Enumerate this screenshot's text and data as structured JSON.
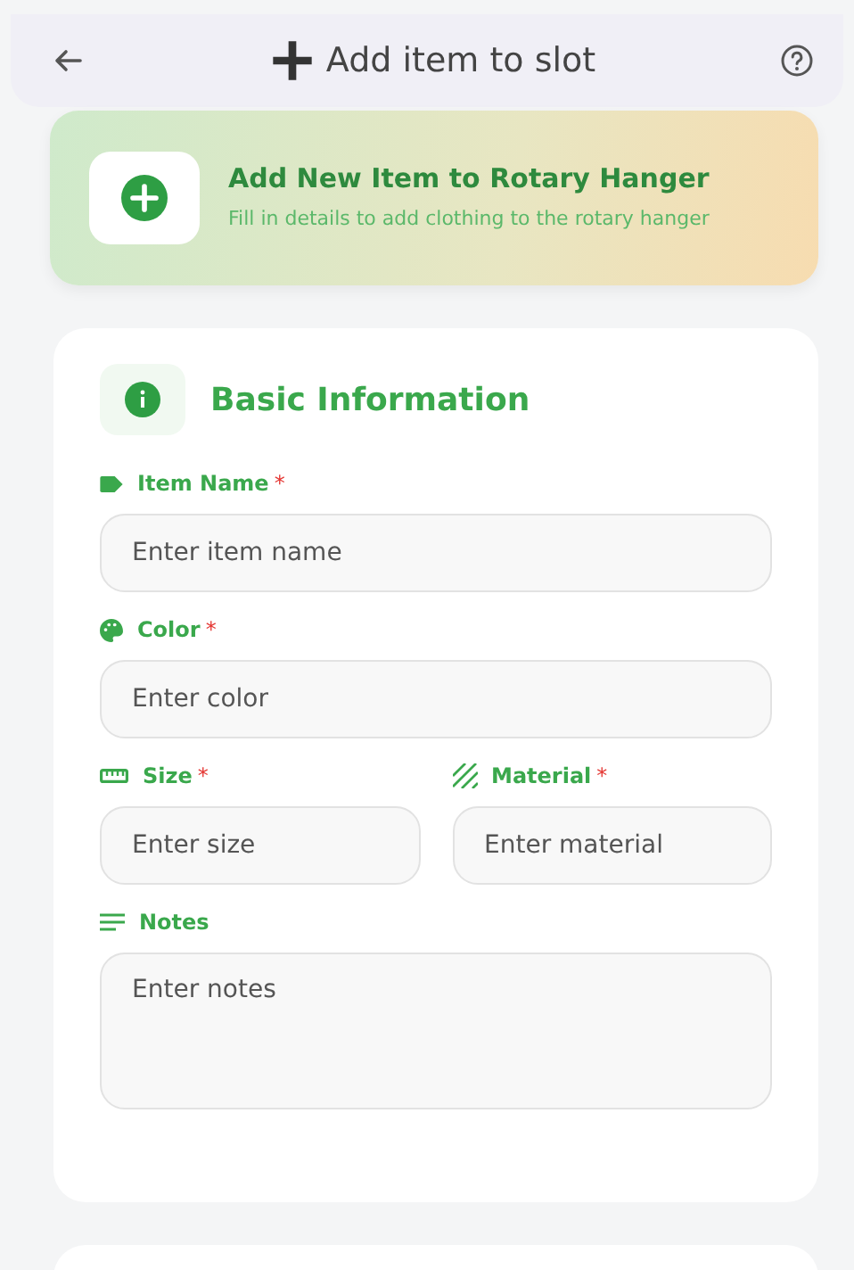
{
  "header": {
    "title": "Add item to slot"
  },
  "banner": {
    "title": "Add New Item to Rotary Hanger",
    "subtitle": "Fill in details to add clothing to the rotary hanger"
  },
  "section": {
    "title": "Basic Information",
    "rows": [
      [
        {
          "label": "Item Name",
          "required_mark": "*",
          "kind": "input",
          "placeholder": "Enter item name"
        }
      ],
      [
        {
          "label": "Color",
          "required_mark": "*",
          "kind": "input",
          "placeholder": "Enter color"
        }
      ],
      [
        {
          "label": "Size",
          "required_mark": "*",
          "kind": "input",
          "placeholder": "Enter size"
        },
        {
          "label": "Material",
          "required_mark": "*",
          "kind": "input",
          "placeholder": "Enter material"
        }
      ],
      [
        {
          "label": "Notes",
          "kind": "textarea",
          "placeholder": "Enter notes"
        }
      ]
    ]
  }
}
